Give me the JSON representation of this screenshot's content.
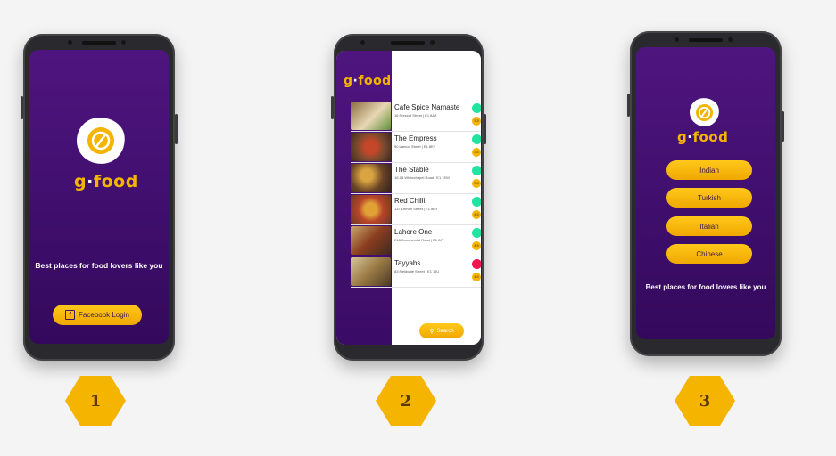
{
  "brand": {
    "logo_main": "g",
    "logo_dot": "·",
    "logo_tail": "food",
    "accent": "#f4b400",
    "background": "#4a137a"
  },
  "screen1": {
    "tagline": "Best places for food lovers like you",
    "login_button": "Facebook Login",
    "login_icon": "facebook-icon",
    "step": "1"
  },
  "screen2": {
    "search_button": "Search",
    "search_icon": "magnifier-icon",
    "step": "2",
    "restaurants": [
      {
        "name": "Cafe Spice Namaste",
        "address": "16 Prescot Street | E1 8AZ",
        "status_color": "#22e3a0",
        "rating": "3.5"
      },
      {
        "name": "The Empress",
        "address": "90 Lamon Street | E1 8EY",
        "status_color": "#22e3a0",
        "rating": "3.5"
      },
      {
        "name": "The Stable",
        "address": "16-18 Whitechapel Road | E1 1EW",
        "status_color": "#22e3a0",
        "rating": "3.8"
      },
      {
        "name": "Red Chilli",
        "address": "137 Lemon Street | E1 8EY",
        "status_color": "#22e3a0",
        "rating": "4.5"
      },
      {
        "name": "Lahore One",
        "address": "218 Commercial Road | E1 2JT",
        "status_color": "#22e3a0",
        "rating": "4.5"
      },
      {
        "name": "Tayyabs",
        "address": "83 Fieldgate Street | E1 1JU",
        "status_color": "#f0174e",
        "rating": "4.5"
      }
    ]
  },
  "screen3": {
    "categories": [
      "Indian",
      "Turkish",
      "Italian",
      "Chinese"
    ],
    "tagline": "Best places for food lovers like you",
    "step": "3"
  }
}
